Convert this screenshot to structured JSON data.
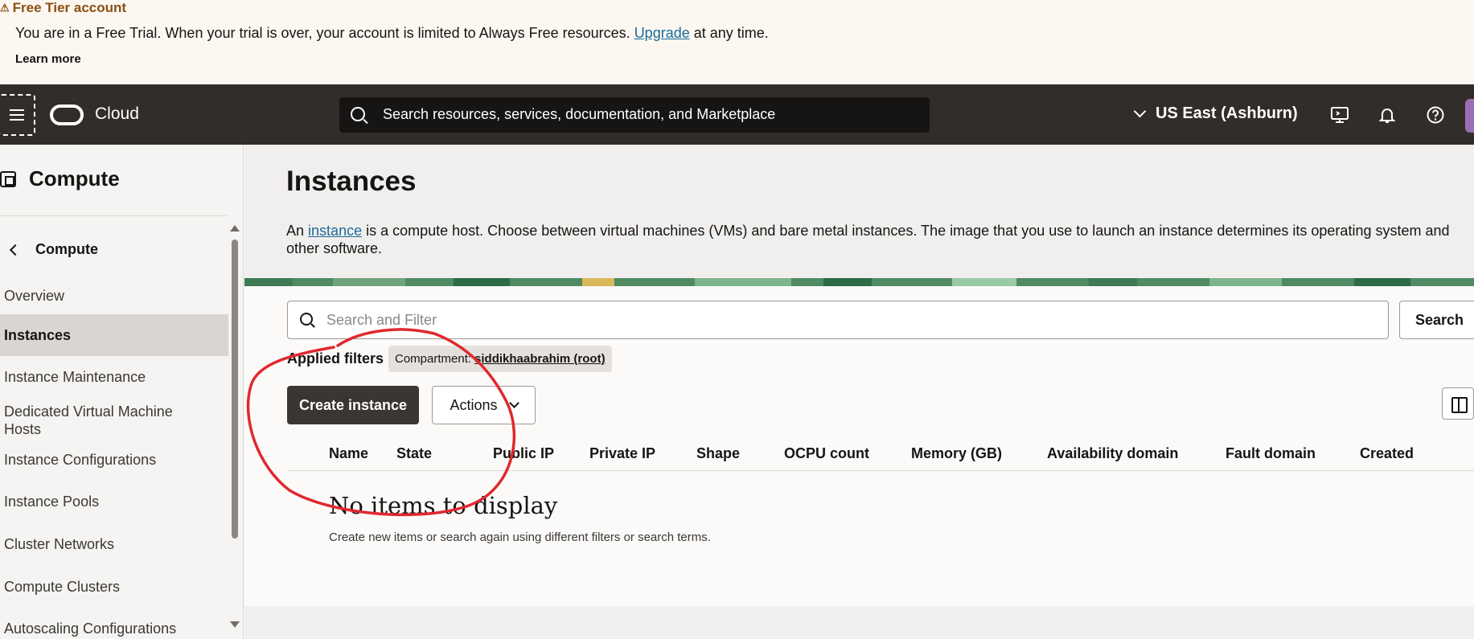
{
  "banner": {
    "title": "Free Tier account",
    "message_before": "You are in a Free Trial. When your trial is over, your account is limited to Always Free resources.",
    "upgrade_link": "Upgrade",
    "message_after": "at any time.",
    "learn_more": "Learn more"
  },
  "topnav": {
    "brand": "Cloud",
    "search_placeholder": "Search resources, services, documentation, and Marketplace",
    "region": "US East (Ashburn)",
    "icons": [
      "menu-icon",
      "oracle-logo",
      "search-icon",
      "chevron-down-icon",
      "cloud-shell-icon",
      "bell-icon",
      "help-icon"
    ]
  },
  "sidebar": {
    "title": "Compute",
    "back_label": "Compute",
    "items": [
      {
        "label": "Overview",
        "active": false
      },
      {
        "label": "Instances",
        "active": true
      },
      {
        "label": "Instance Maintenance",
        "active": false
      },
      {
        "label": "Dedicated Virtual Machine Hosts",
        "active": false
      },
      {
        "label": "Instance Configurations",
        "active": false
      },
      {
        "label": "Instance Pools",
        "active": false
      },
      {
        "label": "Cluster Networks",
        "active": false
      },
      {
        "label": "Compute Clusters",
        "active": false
      },
      {
        "label": "Autoscaling Configurations",
        "active": false
      }
    ]
  },
  "main": {
    "title": "Instances",
    "intro_before": "An",
    "intro_link": "instance",
    "intro_after": "is a compute host. Choose between virtual machines (VMs) and bare metal instances. The image that you use to launch an instance determines its operating system and other software.",
    "filter_placeholder": "Search and Filter",
    "search_button": "Search",
    "applied_filters_label": "Applied filters",
    "filter_chip_key": "Compartment:",
    "filter_chip_value": "siddikhaabrahim (root)",
    "create_button": "Create instance",
    "actions_button": "Actions",
    "columns": [
      "Name",
      "State",
      "Public IP",
      "Private IP",
      "Shape",
      "OCPU count",
      "Memory (GB)",
      "Availability domain",
      "Fault domain",
      "Created"
    ],
    "empty_title": "No items to display",
    "empty_subtitle": "Create new items or search again using different filters or search terms."
  },
  "colors": {
    "nav_bg": "#312d2a",
    "banner_title": "#8a4f13",
    "link": "#1a6b9c",
    "primary_button": "#3a3632",
    "annotation": "#e0282e"
  }
}
